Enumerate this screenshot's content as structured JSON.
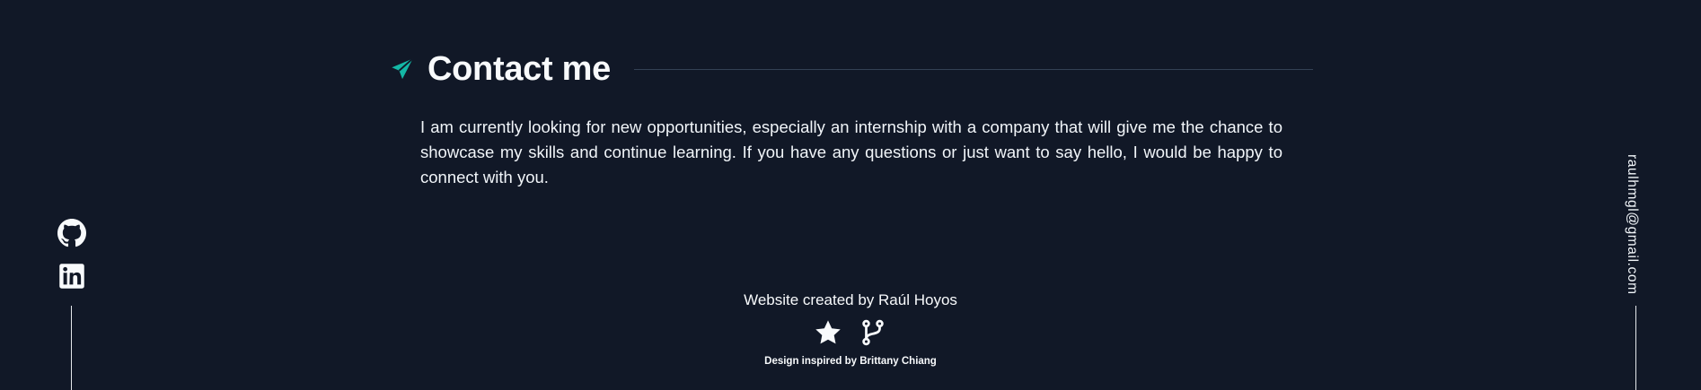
{
  "contact": {
    "icon": "paper-plane-icon",
    "title": "Contact me",
    "body": "I am currently looking for new opportunities, especially an internship with a company that will give me the chance to showcase my skills and continue learning. If you have any questions or just want to say hello, I would be happy to connect with you."
  },
  "social": {
    "links": [
      {
        "name": "github",
        "icon": "github-icon"
      },
      {
        "name": "linkedin",
        "icon": "linkedin-icon"
      }
    ]
  },
  "email": {
    "address": "raulhmgl@gmail.com"
  },
  "footer": {
    "credit": "Website created by Raúl Hoyos",
    "icons": [
      "star-icon",
      "git-fork-icon"
    ],
    "design": "Design inspired by Brittany Chiang"
  },
  "colors": {
    "background": "#111827",
    "accent": "#14b8a6",
    "text": "#f1f5f9",
    "divider": "#334155"
  }
}
